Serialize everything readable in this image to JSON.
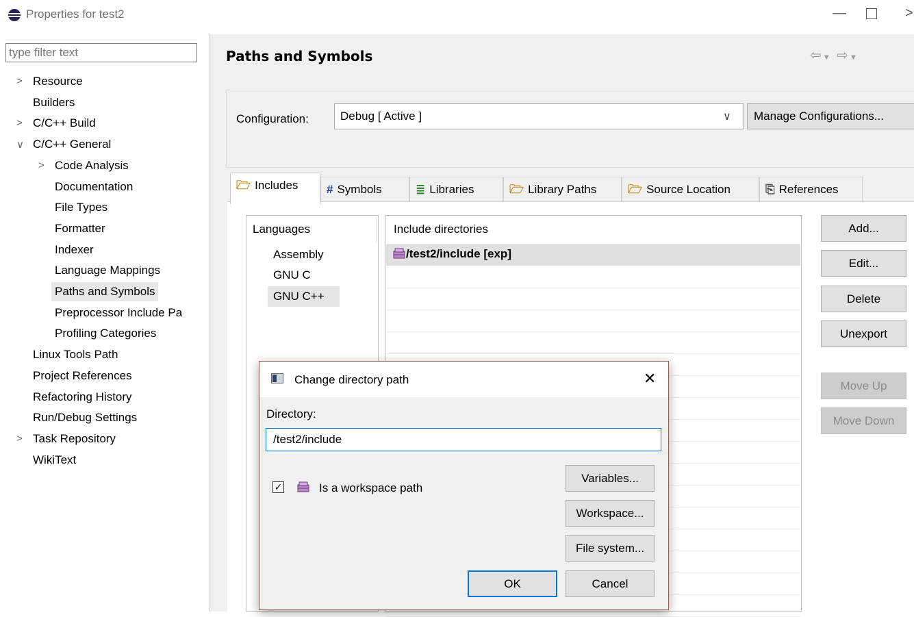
{
  "window": {
    "title": "Properties for test2",
    "minimize_icon": "minimize-icon",
    "maximize_icon": "maximize-icon",
    "close_icon": "close-icon"
  },
  "filter": {
    "placeholder": "type filter text"
  },
  "tree": [
    {
      "label": "Resource",
      "level": 0,
      "chevron": "right"
    },
    {
      "label": "Builders",
      "level": 0,
      "chevron": "none"
    },
    {
      "label": "C/C++ Build",
      "level": 0,
      "chevron": "right"
    },
    {
      "label": "C/C++ General",
      "level": 0,
      "chevron": "down"
    },
    {
      "label": "Code Analysis",
      "level": 1,
      "chevron": "right"
    },
    {
      "label": "Documentation",
      "level": 1,
      "chevron": "none"
    },
    {
      "label": "File Types",
      "level": 1,
      "chevron": "none"
    },
    {
      "label": "Formatter",
      "level": 1,
      "chevron": "none"
    },
    {
      "label": "Indexer",
      "level": 1,
      "chevron": "none"
    },
    {
      "label": "Language Mappings",
      "level": 1,
      "chevron": "none"
    },
    {
      "label": "Paths and Symbols",
      "level": 1,
      "chevron": "none",
      "selected": true
    },
    {
      "label": "Preprocessor Include Pa",
      "level": 1,
      "chevron": "none"
    },
    {
      "label": "Profiling Categories",
      "level": 1,
      "chevron": "none"
    },
    {
      "label": "Linux Tools Path",
      "level": 0,
      "chevron": "none"
    },
    {
      "label": "Project References",
      "level": 0,
      "chevron": "none"
    },
    {
      "label": "Refactoring History",
      "level": 0,
      "chevron": "none"
    },
    {
      "label": "Run/Debug Settings",
      "level": 0,
      "chevron": "none"
    },
    {
      "label": "Task Repository",
      "level": 0,
      "chevron": "right"
    },
    {
      "label": "WikiText",
      "level": 0,
      "chevron": "none"
    }
  ],
  "page": {
    "title": "Paths and Symbols"
  },
  "config": {
    "label": "Configuration:",
    "value": "Debug  [ Active ]",
    "manage_label": "Manage Configurations..."
  },
  "tabs": [
    {
      "label": "Includes",
      "icon": "folder-include-icon",
      "active": true
    },
    {
      "label": "Symbols",
      "icon": "hash-icon"
    },
    {
      "label": "Libraries",
      "icon": "libraries-icon"
    },
    {
      "label": "Library Paths",
      "icon": "folder-library-icon"
    },
    {
      "label": "Source Location",
      "icon": "folder-source-icon"
    },
    {
      "label": "References",
      "icon": "references-icon"
    }
  ],
  "languages": {
    "header": "Languages",
    "items": [
      "Assembly",
      "GNU C",
      "GNU C++"
    ],
    "selected": "GNU C++"
  },
  "include_dirs": {
    "header": "Include directories",
    "entries": [
      "/test2/include [exp]"
    ]
  },
  "side_buttons": {
    "add": "Add...",
    "edit": "Edit...",
    "delete": "Delete",
    "unexport": "Unexport",
    "move_up": "Move Up",
    "move_down": "Move Down"
  },
  "dialog": {
    "title": "Change directory path",
    "directory_label": "Directory:",
    "directory_value": "/test2/include",
    "workspace_checkbox_label": "Is a workspace path",
    "workspace_checked": true,
    "variables_label": "Variables...",
    "workspace_label": "Workspace...",
    "filesystem_label": "File system...",
    "ok_label": "OK",
    "cancel_label": "Cancel"
  }
}
